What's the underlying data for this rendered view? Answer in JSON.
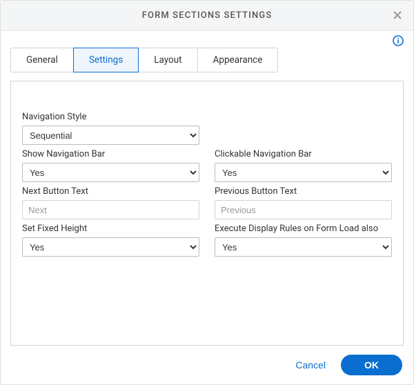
{
  "header": {
    "title": "FORM SECTIONS SETTINGS"
  },
  "tabs": {
    "general": "General",
    "settings": "Settings",
    "layout": "Layout",
    "appearance": "Appearance",
    "active": "settings"
  },
  "fields": {
    "navigation_style": {
      "label": "Navigation Style",
      "value": "Sequential"
    },
    "show_nav_bar": {
      "label": "Show Navigation Bar",
      "value": "Yes"
    },
    "clickable_nav_bar": {
      "label": "Clickable Navigation Bar",
      "value": "Yes"
    },
    "next_button_text": {
      "label": "Next Button Text",
      "placeholder": "Next",
      "value": ""
    },
    "previous_button_text": {
      "label": "Previous Button Text",
      "placeholder": "Previous",
      "value": ""
    },
    "set_fixed_height": {
      "label": "Set Fixed Height",
      "value": "Yes"
    },
    "execute_display_rules": {
      "label": "Execute Display Rules on Form Load also",
      "value": "Yes"
    }
  },
  "footer": {
    "cancel": "Cancel",
    "ok": "OK"
  }
}
